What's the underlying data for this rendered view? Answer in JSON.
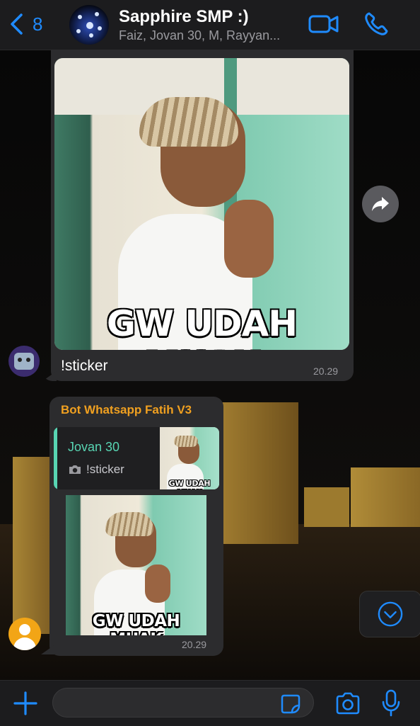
{
  "header": {
    "back_count": "8",
    "group_name": "Sapphire SMP :)",
    "members_preview": "Faiz, Jovan 30, M, Rayyan..."
  },
  "messages": [
    {
      "type": "image",
      "meme_text": "GW UDAH MUAK",
      "caption": "!sticker",
      "time": "20.29"
    },
    {
      "type": "sticker-reply",
      "sender": "Bot Whatsapp Fatih V3",
      "quote": {
        "author": "Jovan 30",
        "text": "!sticker",
        "thumb_meme_text": "GW UDAH MUAK"
      },
      "meme_text": "GW UDAH MUAK",
      "time": "20.29"
    }
  ],
  "composer": {
    "value": "",
    "placeholder": ""
  },
  "icons": {
    "back": "chevron-left-icon",
    "video": "video-camera-icon",
    "call": "phone-icon",
    "forward": "forward-arrow-icon",
    "scroll_down": "chevron-down-circle-icon",
    "plus": "plus-icon",
    "sticker": "sticker-icon",
    "camera": "camera-icon",
    "mic": "microphone-icon"
  },
  "colors": {
    "accent": "#1f8bff",
    "bubble": "#2c2c2e",
    "sender_name": "#f0a020",
    "quote_accent": "#58d5b3"
  }
}
